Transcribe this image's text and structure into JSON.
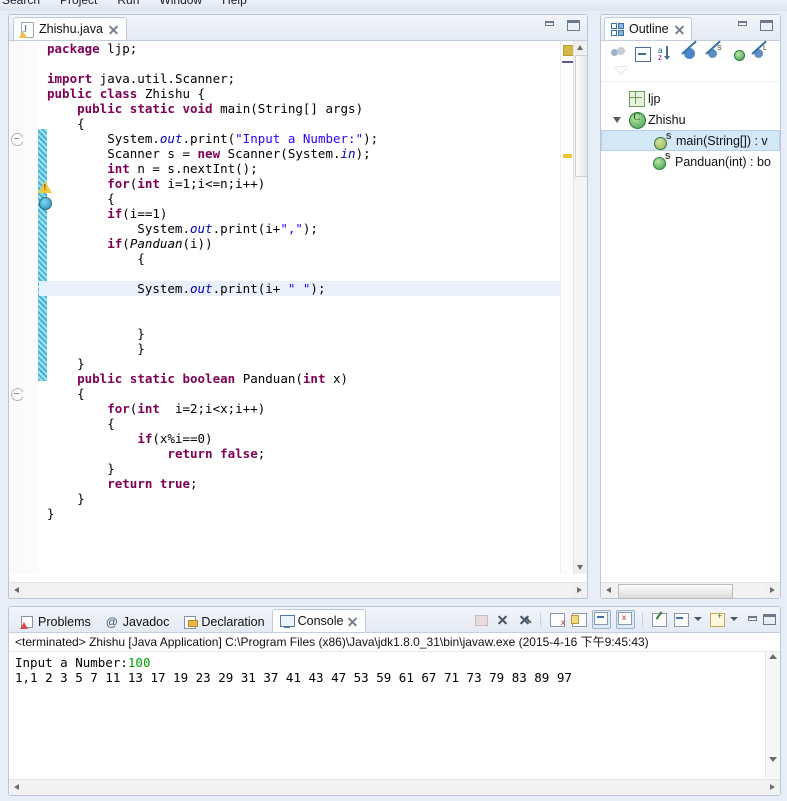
{
  "menubar": {
    "items": [
      "Search",
      "Project",
      "Run",
      "Window",
      "Help"
    ]
  },
  "editor": {
    "tab": {
      "label": "Zhishu.java",
      "icon": "java-file-warning-icon",
      "close": "close-icon"
    },
    "window_buttons": {
      "minimize": "minimize-icon",
      "maximize": "maximize-icon"
    },
    "code_lines": [
      {
        "indent": 1,
        "tokens": [
          {
            "t": "package",
            "c": "kw"
          },
          {
            "t": " ljp;",
            "c": ""
          }
        ]
      },
      {
        "indent": 1,
        "tokens": []
      },
      {
        "indent": 1,
        "tokens": [
          {
            "t": "import",
            "c": "kw"
          },
          {
            "t": " java.util.Scanner;",
            "c": ""
          }
        ]
      },
      {
        "indent": 1,
        "tokens": [
          {
            "t": "public",
            "c": "kw"
          },
          {
            "t": " ",
            "c": ""
          },
          {
            "t": "class",
            "c": "kw"
          },
          {
            "t": " Zhishu {",
            "c": ""
          }
        ]
      },
      {
        "indent": 2,
        "tokens": [
          {
            "t": "public",
            "c": "kw"
          },
          {
            "t": " ",
            "c": ""
          },
          {
            "t": "static",
            "c": "kw"
          },
          {
            "t": " ",
            "c": ""
          },
          {
            "t": "void",
            "c": "kw"
          },
          {
            "t": " main(String[] args)",
            "c": ""
          }
        ]
      },
      {
        "indent": 2,
        "tokens": [
          {
            "t": "{",
            "c": ""
          }
        ]
      },
      {
        "indent": 3,
        "tokens": [
          {
            "t": "System.",
            "c": ""
          },
          {
            "t": "out",
            "c": "fld"
          },
          {
            "t": ".print(",
            "c": ""
          },
          {
            "t": "\"Input a Number:\"",
            "c": "str"
          },
          {
            "t": ");",
            "c": ""
          }
        ]
      },
      {
        "indent": 3,
        "tokens": [
          {
            "t": "Scanner s = ",
            "c": ""
          },
          {
            "t": "new",
            "c": "kw"
          },
          {
            "t": " Scanner(System.",
            "c": ""
          },
          {
            "t": "in",
            "c": "fld"
          },
          {
            "t": ");",
            "c": ""
          }
        ]
      },
      {
        "indent": 3,
        "tokens": [
          {
            "t": "int",
            "c": "kw"
          },
          {
            "t": " n = s.nextInt();",
            "c": ""
          }
        ]
      },
      {
        "indent": 3,
        "tokens": [
          {
            "t": "for",
            "c": "kw"
          },
          {
            "t": "(",
            "c": ""
          },
          {
            "t": "int",
            "c": "kw"
          },
          {
            "t": " i=1;i<=n;i++)",
            "c": ""
          }
        ]
      },
      {
        "indent": 3,
        "tokens": [
          {
            "t": "{",
            "c": ""
          }
        ]
      },
      {
        "indent": 3,
        "tokens": [
          {
            "t": "if",
            "c": "kw"
          },
          {
            "t": "(i==1)",
            "c": ""
          }
        ]
      },
      {
        "indent": 4,
        "tokens": [
          {
            "t": "System.",
            "c": ""
          },
          {
            "t": "out",
            "c": "fld"
          },
          {
            "t": ".print(i+",
            "c": ""
          },
          {
            "t": "\",\"",
            "c": "str"
          },
          {
            "t": ");",
            "c": ""
          }
        ]
      },
      {
        "indent": 3,
        "tokens": [
          {
            "t": "if",
            "c": "kw"
          },
          {
            "t": "(",
            "c": ""
          },
          {
            "t": "Panduan",
            "c": "mth"
          },
          {
            "t": "(i))",
            "c": ""
          }
        ]
      },
      {
        "indent": 4,
        "tokens": [
          {
            "t": "{",
            "c": ""
          }
        ]
      },
      {
        "indent": 1,
        "tokens": []
      },
      {
        "indent": 4,
        "tokens": [
          {
            "t": "System.",
            "c": ""
          },
          {
            "t": "out",
            "c": "fld"
          },
          {
            "t": ".print(i+ ",
            "c": ""
          },
          {
            "t": "\" \"",
            "c": "str"
          },
          {
            "t": ");",
            "c": ""
          }
        ],
        "highlight": true
      },
      {
        "indent": 1,
        "tokens": []
      },
      {
        "indent": 1,
        "tokens": []
      },
      {
        "indent": 4,
        "tokens": [
          {
            "t": "}",
            "c": ""
          }
        ]
      },
      {
        "indent": 4,
        "tokens": [
          {
            "t": "}",
            "c": ""
          }
        ]
      },
      {
        "indent": 2,
        "tokens": [
          {
            "t": "}",
            "c": ""
          }
        ]
      },
      {
        "indent": 2,
        "tokens": [
          {
            "t": "public",
            "c": "kw"
          },
          {
            "t": " ",
            "c": ""
          },
          {
            "t": "static",
            "c": "kw"
          },
          {
            "t": " ",
            "c": ""
          },
          {
            "t": "boolean",
            "c": "kw"
          },
          {
            "t": " Panduan(",
            "c": ""
          },
          {
            "t": "int",
            "c": "kw"
          },
          {
            "t": " x)",
            "c": ""
          }
        ]
      },
      {
        "indent": 2,
        "tokens": [
          {
            "t": "{",
            "c": ""
          }
        ]
      },
      {
        "indent": 3,
        "tokens": [
          {
            "t": "for",
            "c": "kw"
          },
          {
            "t": "(",
            "c": ""
          },
          {
            "t": "int",
            "c": "kw"
          },
          {
            "t": "  i=2;i<x;i++)",
            "c": ""
          }
        ]
      },
      {
        "indent": 3,
        "tokens": [
          {
            "t": "{",
            "c": ""
          }
        ]
      },
      {
        "indent": 4,
        "tokens": [
          {
            "t": "if",
            "c": "kw"
          },
          {
            "t": "(x%i==0)",
            "c": ""
          }
        ]
      },
      {
        "indent": 5,
        "tokens": [
          {
            "t": "return",
            "c": "kw"
          },
          {
            "t": " ",
            "c": ""
          },
          {
            "t": "false",
            "c": "kw"
          },
          {
            "t": ";",
            "c": ""
          }
        ]
      },
      {
        "indent": 3,
        "tokens": [
          {
            "t": "}",
            "c": ""
          }
        ]
      },
      {
        "indent": 3,
        "tokens": [
          {
            "t": "return",
            "c": "kw"
          },
          {
            "t": " ",
            "c": ""
          },
          {
            "t": "true",
            "c": "kw"
          },
          {
            "t": ";",
            "c": ""
          }
        ]
      },
      {
        "indent": 2,
        "tokens": [
          {
            "t": "}",
            "c": ""
          }
        ]
      },
      {
        "indent": 1,
        "tokens": [
          {
            "t": "}",
            "c": ""
          }
        ]
      }
    ],
    "gutter": {
      "warning_icon": "warning-icon",
      "breakpoint_icon": "breakpoint-icon",
      "fold_icons": [
        "fold-collapse-icon",
        "fold-collapse-icon"
      ]
    }
  },
  "outline": {
    "tab_label": "Outline",
    "tab_icon": "outline-icon",
    "close": "close-icon",
    "window_buttons": {
      "minimize": "minimize-icon",
      "maximize": "maximize-icon"
    },
    "toolbar": [
      "focus-on-active-task-icon",
      "collapse-all-icon",
      "sort-icon",
      "hide-fields-icon",
      "hide-static-icon",
      "hide-non-public-icon",
      "hide-local-types-icon"
    ],
    "view_menu": "view-menu-icon",
    "tree": [
      {
        "label": "ljp",
        "icon": "package-icon",
        "depth": 0,
        "selected": false
      },
      {
        "label": "Zhishu",
        "icon": "class-icon",
        "depth": 0,
        "selected": false,
        "expanded": true
      },
      {
        "label": "main(String[]) : v",
        "icon": "method-warning-icon",
        "depth": 1,
        "selected": true,
        "modifier": "S"
      },
      {
        "label": "Panduan(int) : bo",
        "icon": "method-icon",
        "depth": 1,
        "selected": false,
        "modifier": "S"
      }
    ]
  },
  "console": {
    "tabs": [
      {
        "label": "Problems",
        "icon": "problems-icon",
        "active": false
      },
      {
        "label": "Javadoc",
        "icon": "javadoc-icon",
        "active": false
      },
      {
        "label": "Declaration",
        "icon": "declaration-icon",
        "active": false
      },
      {
        "label": "Console",
        "icon": "console-icon",
        "active": true
      }
    ],
    "close": "close-icon",
    "toolbar": [
      "terminate-disabled-icon",
      "remove-launch-icon",
      "remove-all-terminated-icon",
      "clear-console-icon",
      "scroll-lock-icon",
      "show-console-on-output-icon",
      "show-console-on-error-icon",
      "pin-console-icon",
      "display-selected-console-icon",
      "display-selected-console-dropdown-icon",
      "open-console-icon",
      "open-console-dropdown-icon",
      "minimize-icon",
      "maximize-icon"
    ],
    "header": "<terminated> Zhishu [Java Application] C:\\Program Files (x86)\\Java\\jdk1.8.0_31\\bin\\javaw.exe (2015-4-16 下午9:45:43)",
    "output_prompt": "Input a Number:",
    "output_input": "100",
    "output_result": "1,1 2 3 5 7 11 13 17 19 23 29 31 37 41 43 47 53 59 61 67 71 73 79 83 89 97"
  },
  "colors": {
    "keyword": "#7f0055",
    "string": "#2a00ff",
    "field": "#0000c0",
    "selection": "#e8f1fb",
    "tree_selection": "#d4e7f7",
    "change_bar": "#3fb6d8",
    "console_input": "#00a000"
  }
}
